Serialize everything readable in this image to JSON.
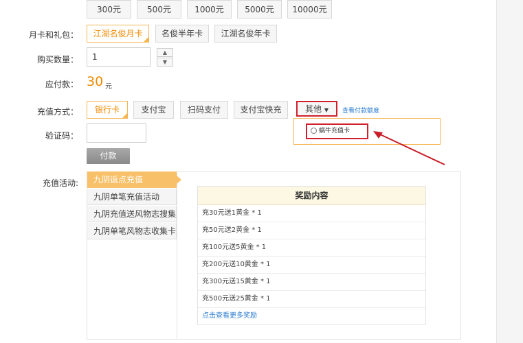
{
  "amounts": [
    "300元",
    "500元",
    "1000元",
    "5000元",
    "10000元"
  ],
  "monthly_card": {
    "label": "月卡和礼包：",
    "options": [
      "江湖名俊月卡",
      "名俊半年卡",
      "江湖名俊年卡"
    ],
    "selected_index": 0
  },
  "quantity": {
    "label": "购买数量：",
    "value": "1"
  },
  "payable": {
    "label": "应付款：",
    "amount": "30",
    "unit": "元"
  },
  "payment": {
    "label": "充值方式：",
    "methods": [
      "银行卡",
      "支付宝",
      "扫码支付",
      "支付宝快充"
    ],
    "selected_index": 0,
    "other_label": "其他",
    "limit_link": "查看付款额度",
    "dropdown_option": "蜗牛充值卡"
  },
  "captcha": {
    "label": "验证码："
  },
  "pay_button": "付款",
  "activity": {
    "label": "充值活动:",
    "tabs": [
      "九阴返点充值",
      "九阴单笔充值活动",
      "九阴充值送风物志搜集卡",
      "九阴单笔风物志收集卡"
    ],
    "active_index": 0,
    "table_header": "奖励内容",
    "rewards": [
      "充30元送1黄金 * 1",
      "充50元送2黄金 * 1",
      "充100元送5黄金 * 1",
      "充200元送10黄金 * 1",
      "充300元送15黄金 * 1",
      "充500元送25黄金 * 1"
    ],
    "more_link": "点击查看更多奖励"
  },
  "colors": {
    "accent": "#f08a00",
    "highlight_red": "#d0202e",
    "tab_active": "#f8c068",
    "link": "#2f7fd1"
  }
}
